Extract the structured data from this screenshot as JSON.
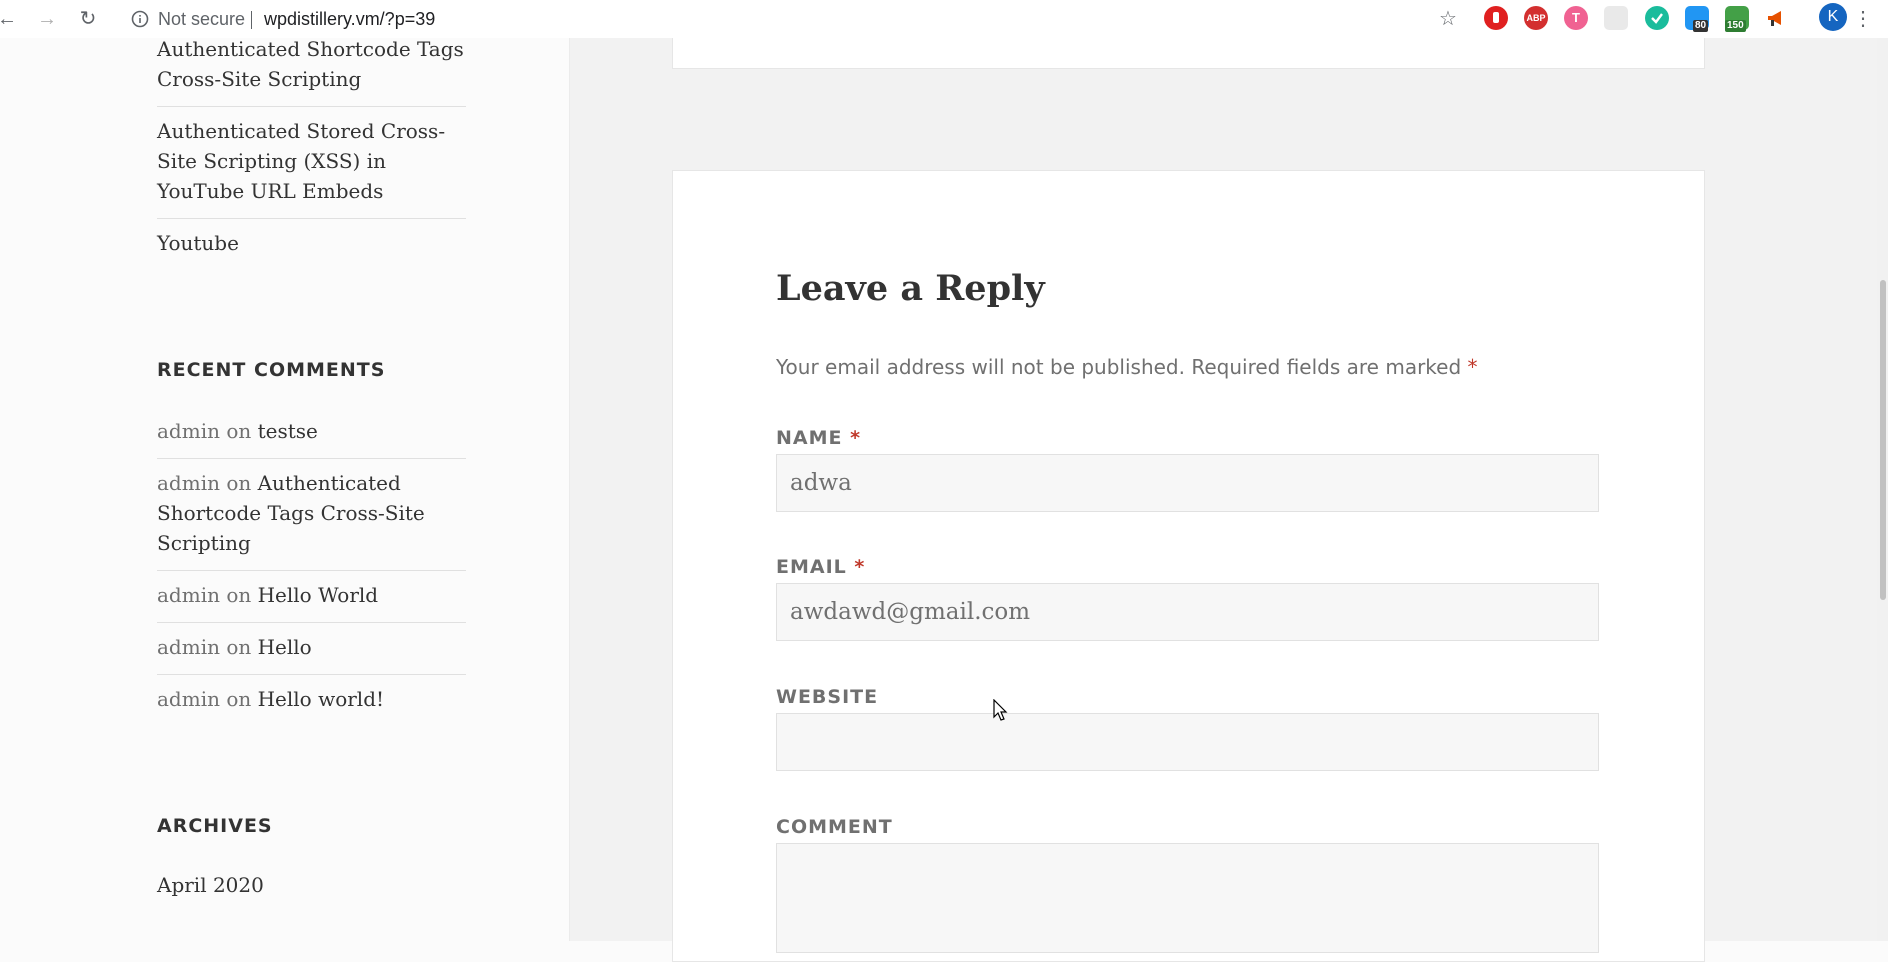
{
  "browser": {
    "security_text": "Not secure",
    "url": "wpdistillery.vm/?p=39",
    "extensions": [
      {
        "name": "adblock-stop",
        "color": "#e02020"
      },
      {
        "name": "abp",
        "label": "ABP",
        "color": "#d32f2f"
      },
      {
        "name": "t-ext",
        "label": "T",
        "color": "#f06292"
      },
      {
        "name": "grey-ext",
        "color": "#d5d5d5"
      },
      {
        "name": "teal-ext",
        "color": "#1abc9c"
      },
      {
        "name": "blue-ext",
        "badge": "80",
        "color": "#2196f3"
      },
      {
        "name": "green-ext",
        "badge": "150",
        "color": "#43a047"
      },
      {
        "name": "megaphone-ext",
        "color": "#e65100"
      }
    ],
    "profile_initial": "K"
  },
  "sidebar": {
    "recent_posts_tail": [
      "Authenticated Shortcode Tags Cross-Site Scripting",
      "Authenticated Stored Cross-Site Scripting (XSS) in YouTube URL Embeds",
      "Youtube"
    ],
    "recent_comments_title": "RECENT COMMENTS",
    "recent_comments": [
      {
        "author": "admin",
        "on": "on",
        "post": "testse"
      },
      {
        "author": "admin",
        "on": "on",
        "post": "Authenticated Shortcode Tags Cross-Site Scripting"
      },
      {
        "author": "admin",
        "on": "on",
        "post": "Hello World"
      },
      {
        "author": "admin",
        "on": "on",
        "post": "Hello"
      },
      {
        "author": "admin",
        "on": "on",
        "post": "Hello world!"
      }
    ],
    "archives_title": "ARCHIVES",
    "archives": [
      "April 2020"
    ]
  },
  "reply": {
    "title": "Leave a Reply",
    "notes": "Your email address will not be published. Required fields are marked",
    "required_mark": "*",
    "name_label": "NAME",
    "name_value": "adwa",
    "email_label": "EMAIL",
    "email_value": "awdawd@gmail.com",
    "website_label": "WEBSITE",
    "website_value": "",
    "comment_label": "COMMENT",
    "comment_value": ""
  },
  "colors": {
    "required": "#c0392b",
    "muted_text": "#707070",
    "body_text": "#333333"
  }
}
